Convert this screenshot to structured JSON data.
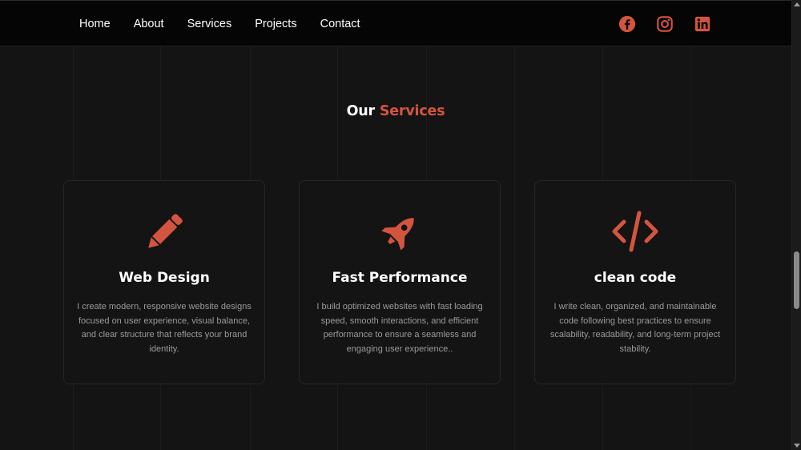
{
  "nav": {
    "links": [
      "Home",
      "About",
      "Services",
      "Projects",
      "Contact"
    ]
  },
  "social": [
    "facebook-icon",
    "instagram-icon",
    "linkedin-icon"
  ],
  "section": {
    "title_part1": "Our",
    "title_part2": "Services"
  },
  "cards": [
    {
      "icon": "pencil-icon",
      "title": "Web Design",
      "text": "I create modern, responsive website designs focused on user experience, visual balance, and clear structure that reflects your brand identity."
    },
    {
      "icon": "rocket-icon",
      "title": "Fast Performance",
      "text": "I build optimized websites with fast loading speed, smooth interactions, and efficient performance to ensure a seamless and engaging user experience.."
    },
    {
      "icon": "code-icon",
      "title": "clean code",
      "text": "I write clean, organized, and maintainable code following best practices to ensure scalability, readability, and long-term project stability."
    }
  ],
  "colors": {
    "accent": "#d4553f",
    "background": "#141414",
    "navbar": "#050505",
    "text_muted": "#9a9a9a"
  }
}
